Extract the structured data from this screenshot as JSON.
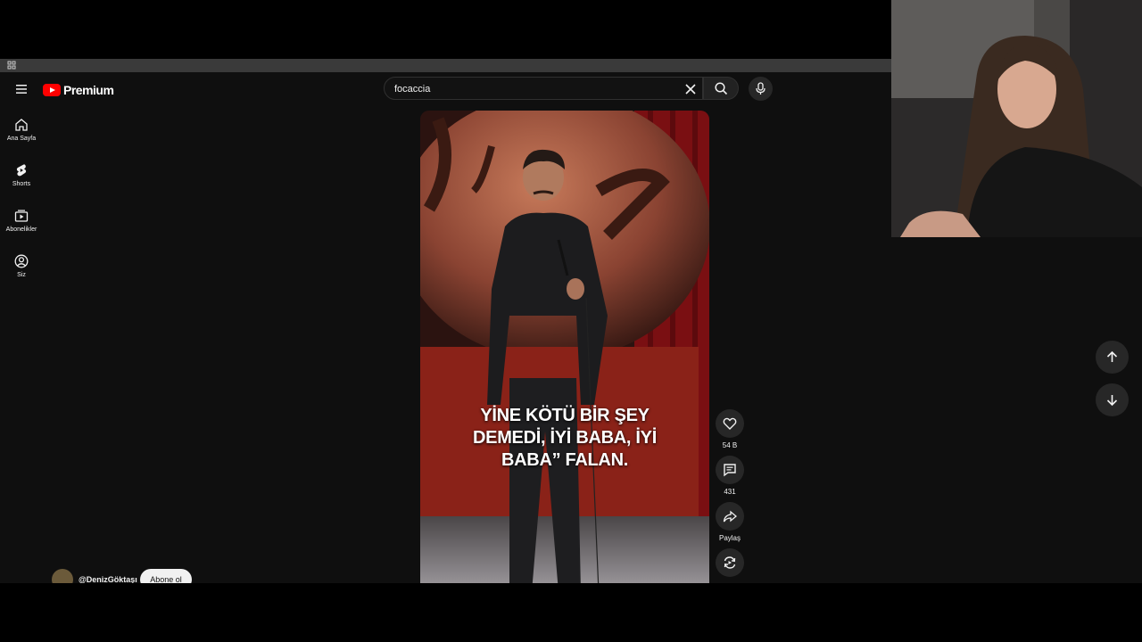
{
  "header": {
    "logo_text": "Premium",
    "search_value": "focaccia"
  },
  "sidebar": {
    "items": [
      {
        "label": "Ana Sayfa",
        "icon": "home-icon"
      },
      {
        "label": "Shorts",
        "icon": "shorts-icon"
      },
      {
        "label": "Abonelikler",
        "icon": "subscriptions-icon"
      },
      {
        "label": "Siz",
        "icon": "account-icon"
      }
    ]
  },
  "video": {
    "caption_line1": "YİNE KÖTÜ BİR ŞEY",
    "caption_line2": "DEMEDİ, İYİ BABA, İYİ",
    "caption_line3": "BABA” FALAN."
  },
  "actions": {
    "like_count": "54 B",
    "comment_count": "431",
    "share_label": "Paylaş"
  },
  "channel": {
    "handle": "@DenizGöktaşı",
    "subscribe_label": "Abone ol"
  },
  "colors": {
    "background": "#0f0f0f",
    "brand_red": "#ff0000",
    "button_bg": "#272727"
  }
}
